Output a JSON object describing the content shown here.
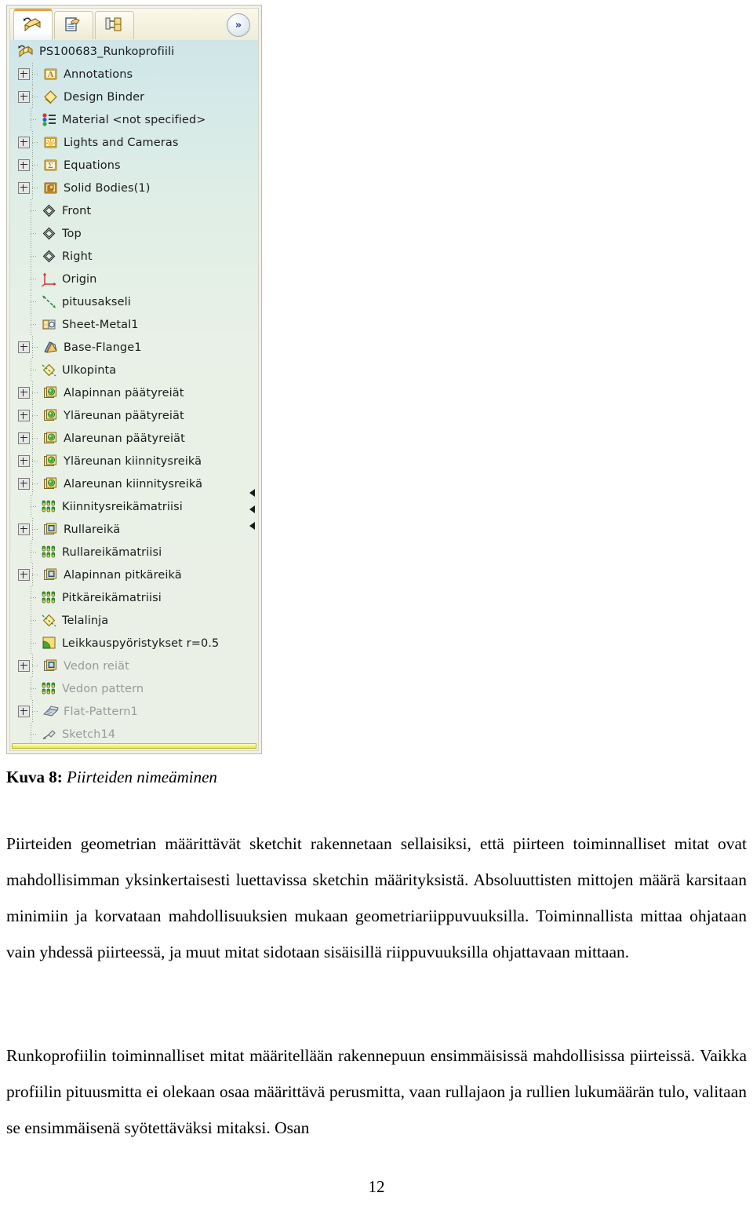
{
  "panel": {
    "title": "FeatureManager design tree",
    "tabs": [
      {
        "name": "feature-manager-tab",
        "icon": "featuremanager-icon",
        "active": true
      },
      {
        "name": "property-manager-tab",
        "icon": "propertymanager-icon",
        "active": false
      },
      {
        "name": "configuration-manager-tab",
        "icon": "configurationmanager-icon",
        "active": false
      }
    ],
    "expand_button": {
      "label": "»",
      "icon": "double-chevron-right-icon"
    },
    "tree": [
      {
        "label": "PS100683_Runkoprofiili",
        "icon": "part-icon",
        "expandable": false,
        "root": true,
        "dim": false
      },
      {
        "label": "Annotations",
        "icon": "annotations-folder-icon",
        "expandable": true,
        "root": false,
        "dim": false
      },
      {
        "label": "Design Binder",
        "icon": "design-binder-icon",
        "expandable": true,
        "root": false,
        "dim": false
      },
      {
        "label": "Material <not specified>",
        "icon": "material-icon",
        "expandable": false,
        "root": false,
        "dim": false
      },
      {
        "label": "Lights and Cameras",
        "icon": "lights-cameras-folder-icon",
        "expandable": true,
        "root": false,
        "dim": false
      },
      {
        "label": "Equations",
        "icon": "equations-folder-icon",
        "expandable": true,
        "root": false,
        "dim": false
      },
      {
        "label": "Solid Bodies(1)",
        "icon": "solid-bodies-folder-icon",
        "expandable": true,
        "root": false,
        "dim": false
      },
      {
        "label": "Front",
        "icon": "plane-icon",
        "expandable": false,
        "root": false,
        "dim": false
      },
      {
        "label": "Top",
        "icon": "plane-icon",
        "expandable": false,
        "root": false,
        "dim": false
      },
      {
        "label": "Right",
        "icon": "plane-icon",
        "expandable": false,
        "root": false,
        "dim": false
      },
      {
        "label": "Origin",
        "icon": "origin-icon",
        "expandable": false,
        "root": false,
        "dim": false
      },
      {
        "label": "pituusakseli",
        "icon": "axis-icon",
        "expandable": false,
        "root": false,
        "dim": false
      },
      {
        "label": "Sheet-Metal1",
        "icon": "sheet-metal-icon",
        "expandable": false,
        "root": false,
        "dim": false
      },
      {
        "label": "Base-Flange1",
        "icon": "base-flange-icon",
        "expandable": true,
        "root": false,
        "dim": false
      },
      {
        "label": "Ulkopinta",
        "icon": "reference-plane-icon",
        "expandable": false,
        "root": false,
        "dim": false
      },
      {
        "label": "Alapinnan päätyreiät",
        "icon": "hole-feature-icon",
        "expandable": true,
        "root": false,
        "dim": false
      },
      {
        "label": "Yläreunan päätyreiät",
        "icon": "hole-feature-icon",
        "expandable": true,
        "root": false,
        "dim": false
      },
      {
        "label": "Alareunan päätyreiät",
        "icon": "hole-feature-icon",
        "expandable": true,
        "root": false,
        "dim": false
      },
      {
        "label": "Yläreunan kiinnitysreikä",
        "icon": "hole-feature-icon",
        "expandable": true,
        "root": false,
        "dim": false
      },
      {
        "label": "Alareunan kiinnitysreikä",
        "icon": "hole-feature-icon",
        "expandable": true,
        "root": false,
        "dim": false
      },
      {
        "label": "Kiinnitysreikämatriisi",
        "icon": "linear-pattern-icon",
        "expandable": false,
        "root": false,
        "dim": false
      },
      {
        "label": "Rullareikä",
        "icon": "cut-extrude-icon",
        "expandable": true,
        "root": false,
        "dim": false
      },
      {
        "label": "Rullareikämatriisi",
        "icon": "linear-pattern-icon",
        "expandable": false,
        "root": false,
        "dim": false
      },
      {
        "label": "Alapinnan pitkäreikä",
        "icon": "cut-extrude-icon",
        "expandable": true,
        "root": false,
        "dim": false
      },
      {
        "label": "Pitkäreikämatriisi",
        "icon": "linear-pattern-icon",
        "expandable": false,
        "root": false,
        "dim": false
      },
      {
        "label": "Telalinja",
        "icon": "reference-plane-icon",
        "expandable": false,
        "root": false,
        "dim": false
      },
      {
        "label": "Leikkauspyöristykset r=0.5",
        "icon": "fillet-icon",
        "expandable": false,
        "root": false,
        "dim": false
      },
      {
        "label": "Vedon reiät",
        "icon": "cut-extrude-icon",
        "expandable": true,
        "root": false,
        "dim": true
      },
      {
        "label": "Vedon pattern",
        "icon": "linear-pattern-icon",
        "expandable": false,
        "root": false,
        "dim": true
      },
      {
        "label": "Flat-Pattern1",
        "icon": "flat-pattern-icon",
        "expandable": true,
        "root": false,
        "dim": true
      },
      {
        "label": "Sketch14",
        "icon": "sketch-icon",
        "expandable": false,
        "root": false,
        "dim": true
      }
    ],
    "rollback_bar": "rollback-bar",
    "scroll_marks": [
      "scroll-mark",
      "scroll-mark",
      "scroll-mark"
    ]
  },
  "document": {
    "caption_prefix": "Kuva 8:",
    "caption_text": "Piirteiden nimeäminen",
    "paragraph_1": "Piirteiden geometrian määrittävät sketchit rakennetaan sellaisiksi, että piirteen toiminnalliset mitat ovat mahdollisimman yksinkertaisesti luettavissa sketchin määrityksistä. Absoluuttisten mittojen määrä karsitaan minimiin ja korvataan mahdollisuuksien mukaan geometriariippuvuuksilla. Toiminnallista mittaa ohjataan vain yhdessä piirteessä, ja muut mitat sidotaan sisäisillä riippuvuuksilla ohjattavaan mittaan.",
    "paragraph_2": "Runkoprofiilin toiminnalliset mitat määritellään rakennepuun ensimmäisissä mahdollisissa piirteissä. Vaikka profiilin pituusmitta ei olekaan osaa määrittävä perusmitta, vaan rullajaon ja rullien lukumäärän tulo, valitaan se ensimmäisenä syötettäväksi mitaksi. Osan",
    "page_number": "12"
  },
  "colors": {
    "panel_bg": "#f3f2ea",
    "tree_bg_top": "#cfe6e9",
    "tree_bg_bottom": "#eaf0e6",
    "accent_tab": "#e8a33d",
    "rollback": "#e8e83c",
    "dim_text": "#9a9a9a"
  }
}
